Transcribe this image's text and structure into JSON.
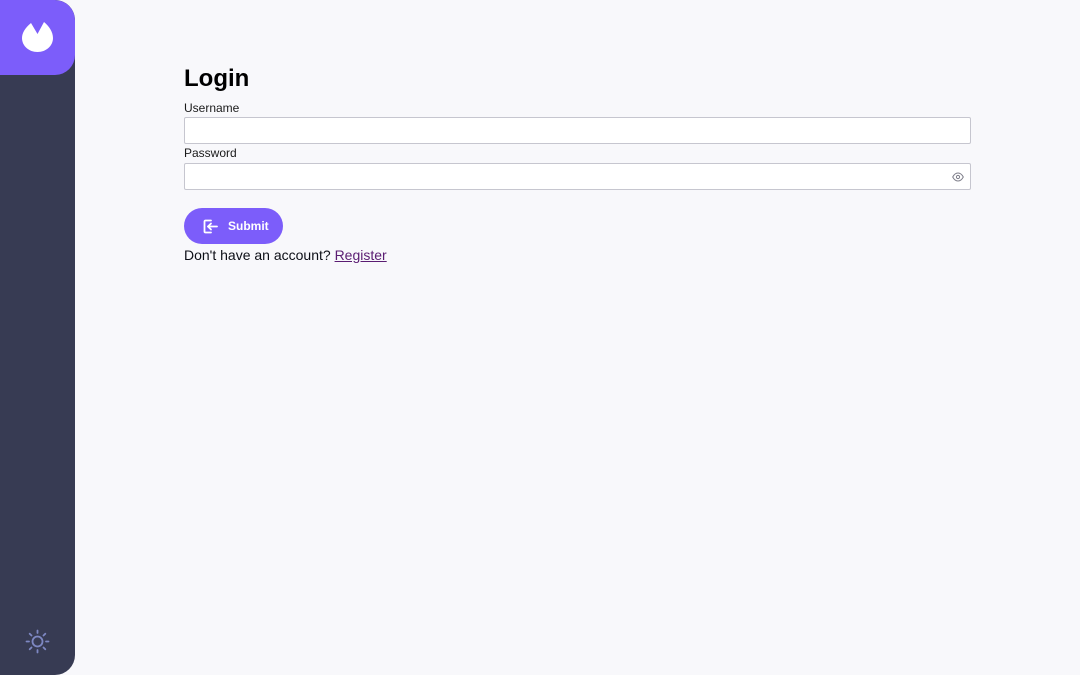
{
  "sidebar": {
    "logo_icon": "app-logo-icon",
    "theme_icon": "sun-icon"
  },
  "login": {
    "title": "Login",
    "username_label": "Username",
    "username_value": "",
    "password_label": "Password",
    "password_value": "",
    "submit_label": "Submit",
    "submit_icon": "login-icon",
    "no_account_text": "Don't have an account?",
    "register_link": "Register"
  },
  "colors": {
    "accent": "#7c5dfa",
    "sidebar": "#373b53",
    "background": "#f8f8fb",
    "link": "#5a1c72"
  }
}
